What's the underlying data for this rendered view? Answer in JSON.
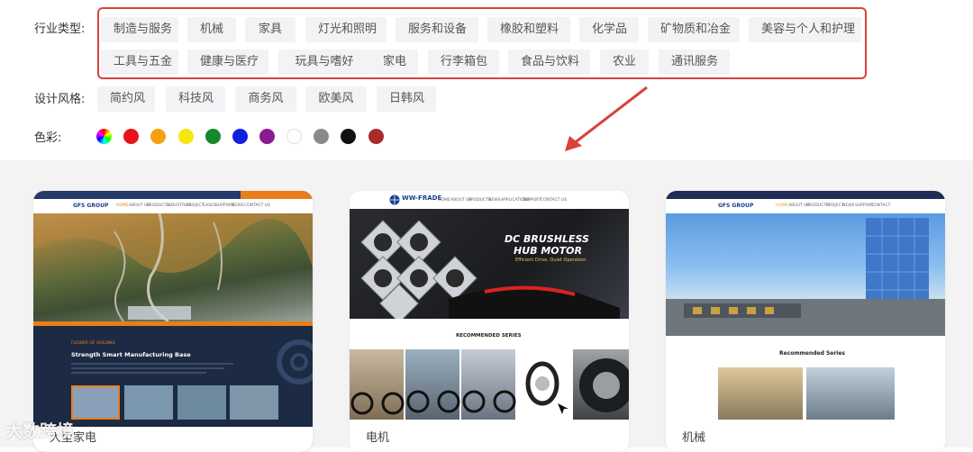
{
  "filters": {
    "industry_label": "行业类型:",
    "industry_tags_row1": [
      "制造与服务",
      "机械",
      "家具",
      "灯光和照明",
      "服务和设备",
      "橡胶和塑料",
      "化学品",
      "矿物质和冶金",
      "美容与个人和护理"
    ],
    "industry_tags_row2": [
      "工具与五金",
      "健康与医疗",
      "玩具与嗜好",
      "家电",
      "行李箱包",
      "食品与饮料",
      "农业",
      "通讯服务"
    ],
    "style_label": "设计风格:",
    "style_tags": [
      "简约风",
      "科技风",
      "商务风",
      "欧美风",
      "日韩风"
    ],
    "color_label": "色彩:",
    "colors": [
      "multicolor",
      "#e8141b",
      "#f5a00f",
      "#f4e80f",
      "#14882a",
      "#1020e0",
      "#8a1a90",
      "#ffffff",
      "#8a8a8a",
      "#111111",
      "#a82c2c"
    ]
  },
  "cards": [
    {
      "caption": "大型家电",
      "logo": "GFS GROUP",
      "nav": [
        "HOME",
        "ABOUT US",
        "PRODUCTS",
        "INDUSTRIES",
        "PROJECT",
        "CASES",
        "SUPPORT",
        "NEWS",
        "CONTACT US"
      ],
      "section_title": "Strength Smart Manufacturing Base",
      "section_kicker": "FLOWER OF HOLDING"
    },
    {
      "caption": "电机",
      "logo": "WW-FRADE",
      "nav": [
        "HOME",
        "ABOUT US",
        "PRODUCTS",
        "NEWS",
        "APPLICATIONS",
        "SUPPORT",
        "CONTACT US"
      ],
      "hero_title_1": "DC BRUSHLESS",
      "hero_title_2": "HUB MOTOR",
      "hero_sub": "Efficient Drive, Quiet Operation",
      "section_title": "RECOMMENDED SERIES"
    },
    {
      "caption": "机械",
      "logo": "GFS GROUP",
      "nav": [
        "HOME",
        "ABOUT US",
        "PRODUCTS",
        "PROJECT",
        "NEWS",
        "SUPPORT",
        "CONTACT"
      ],
      "section_title": "Recommended Series"
    }
  ],
  "watermark": "大数跨境"
}
